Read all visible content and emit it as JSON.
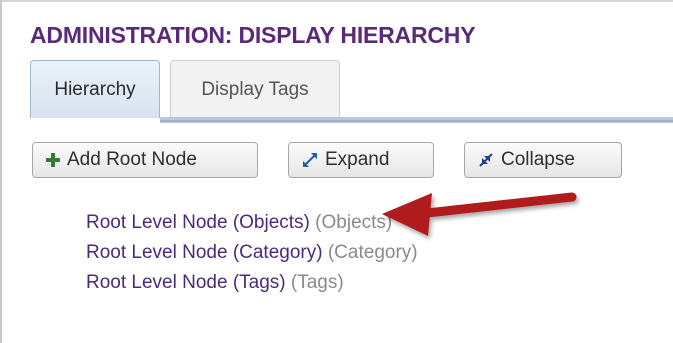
{
  "page": {
    "title": "ADMINISTRATION: DISPLAY HIERARCHY"
  },
  "tabs": [
    {
      "label": "Hierarchy",
      "active": true
    },
    {
      "label": "Display Tags",
      "active": false
    }
  ],
  "toolbar": {
    "add_root_label": "Add Root Node",
    "expand_label": "Expand",
    "collapse_label": "Collapse"
  },
  "tree": {
    "items": [
      {
        "label": "Root Level Node (Objects)",
        "type": "(Objects)"
      },
      {
        "label": "Root Level Node (Category)",
        "type": "(Category)"
      },
      {
        "label": "Root Level Node (Tags)",
        "type": "(Tags)"
      }
    ]
  },
  "icons": {
    "add": "plus-icon",
    "expand": "expand-arrows-icon",
    "collapse": "collapse-arrows-icon",
    "annotation": "red-arrow-icon"
  },
  "colors": {
    "title": "#5a2a7a",
    "node_link": "#4a2a7a",
    "node_type": "#8a8a8a",
    "plus_icon": "#2e7d32",
    "annotation_arrow": "#b01c1c"
  }
}
